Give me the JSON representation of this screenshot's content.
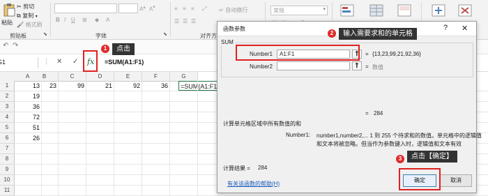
{
  "ribbon": {
    "paste_label": "粘贴",
    "cut_label": "剪切",
    "copy_label": "复制",
    "format_painter_label": "格式刷",
    "clipboard_group": "剪贴板",
    "font_group": "字体",
    "wrap_text_label": "自动换行",
    "align_group": "对齐方式",
    "number_format_value": "常规"
  },
  "formula_bar": {
    "name_box_value": "G1",
    "cancel_glyph": "✕",
    "enter_glyph": "✓",
    "fx_label": "fx",
    "content": "=SUM(A1:F1)"
  },
  "grid": {
    "columns": [
      "A",
      "B",
      "C",
      "D",
      "E",
      "F",
      "G"
    ],
    "rows": [
      {
        "number": "1",
        "cells": [
          "13",
          "23",
          "99",
          "21",
          "92",
          "36"
        ],
        "formula": "=SUM(A1:F1)"
      },
      {
        "number": "2",
        "cells": [
          "19"
        ]
      },
      {
        "number": "3",
        "cells": [
          "36"
        ]
      },
      {
        "number": "4",
        "cells": [
          "72"
        ]
      },
      {
        "number": "5",
        "cells": [
          "51"
        ]
      },
      {
        "number": "6",
        "cells": [
          "26"
        ]
      },
      {
        "number": "7",
        "cells": []
      },
      {
        "number": "8",
        "cells": []
      },
      {
        "number": "9",
        "cells": []
      },
      {
        "number": "10",
        "cells": []
      },
      {
        "number": "11",
        "cells": []
      }
    ]
  },
  "dialog": {
    "title": "函数参数",
    "help_glyph": "?",
    "close_glyph": "✕",
    "function_name": "SUM",
    "number1_label": "Number1",
    "number1_value": "A1:F1",
    "number1_result": "{13,23,99,21,92,36}",
    "number2_label": "Number2",
    "number2_result": "数值",
    "equals": "=",
    "total_result": "284",
    "description": "计算单元格区域中所有数值的和",
    "arg_name": "Number1:",
    "arg_desc_line1": "number1,number2,... 1 到 255 个待求和的数值。单元格中的逻辑值",
    "arg_desc_line2": "和文本将被忽略。但当作为参数键入时，逻辑值和文本有效",
    "result_label": "计算结果 =",
    "result_value": "284",
    "help_link": "有关该函数的帮助(H)",
    "ok_label": "确定",
    "cancel_label": "取消"
  },
  "annotations": {
    "step1_number": "1",
    "step1_text": "点击",
    "step2_number": "2",
    "step2_text": "输入需要求和的单元格",
    "step3_number": "3",
    "step3_text": "点击【确定】",
    "highlight_color": "#e02020"
  }
}
